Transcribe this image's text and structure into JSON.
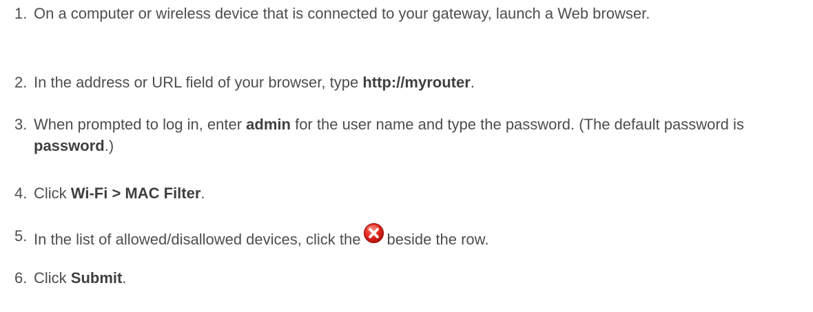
{
  "steps": [
    {
      "number": "1.",
      "text": "On a computer or wireless device that is connected to your gateway, launch a Web browser."
    },
    {
      "number": "2.",
      "pre": "In the address or URL field of your browser, type ",
      "bold": "http://myrouter",
      "post": "."
    },
    {
      "number": "3.",
      "pre": "When prompted to log in, enter ",
      "bold1": "admin",
      "mid": " for the user name and type the password. (The default password is ",
      "bold2": "password",
      "post": ".)"
    },
    {
      "number": "4.",
      "pre": "Click ",
      "bold": "Wi-Fi > MAC Filter",
      "post": "."
    },
    {
      "number": "5.",
      "pre": "In the list of allowed/disallowed devices, click the",
      "icon": "delete-x-icon",
      "post": "beside the row."
    },
    {
      "number": "6.",
      "pre": "Click ",
      "bold": "Submit",
      "post": "."
    }
  ],
  "colors": {
    "text": "#4d4d4d",
    "icon_red": "#e0261d"
  }
}
